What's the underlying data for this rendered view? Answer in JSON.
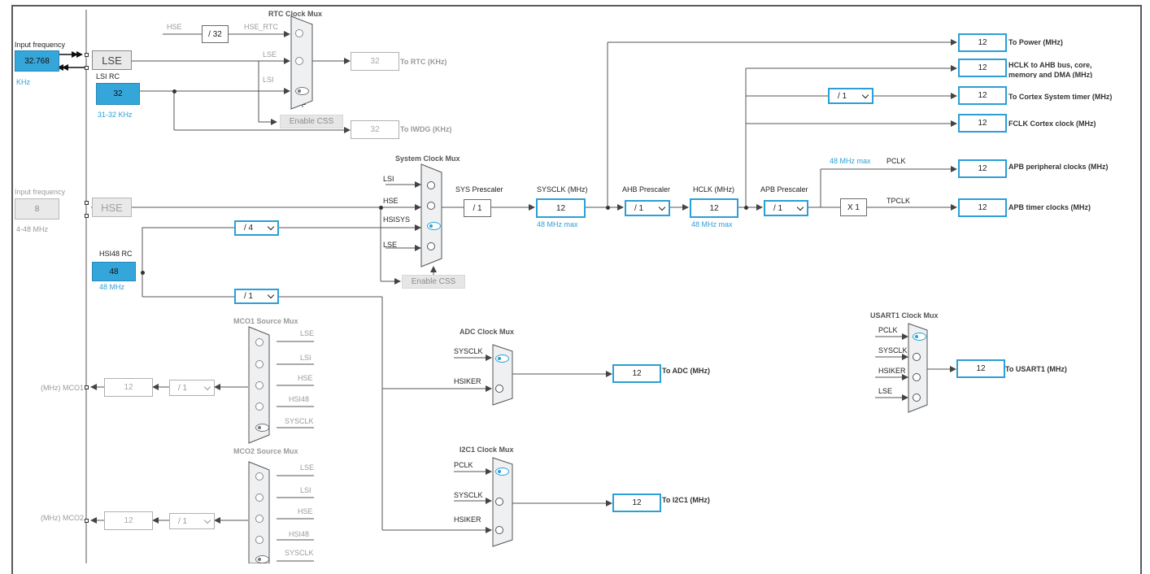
{
  "left_panel": {
    "lse_input_label": "Input frequency",
    "lse_input_value": "32.768",
    "lse_unit": "KHz",
    "lse_label": "LSE",
    "lsi_rc_label": "LSI RC",
    "lsi_rc_value": "32",
    "lsi_range": "31-32 KHz",
    "hse_input_label": "Input frequency",
    "hse_input_value": "8",
    "hse_range": "4-48 MHz",
    "hse_label": "HSE",
    "hsi48_label": "HSI48 RC",
    "hsi48_value": "48",
    "hsi48_unit": "48 MHz"
  },
  "rtc_section": {
    "title": "RTC Clock Mux",
    "hse_label": "HSE",
    "div32": "/ 32",
    "hse_rtc": "HSE_RTC",
    "lse": "LSE",
    "lsi": "LSI",
    "enable_css": "Enable CSS",
    "rtc_value": "32",
    "rtc_label": "To RTC (KHz)",
    "iwdg_value": "32",
    "iwdg_label": "To IWDG (KHz)"
  },
  "system_section": {
    "title": "System Clock Mux",
    "inputs": [
      "LSI",
      "HSE",
      "HSISYS",
      "LSE"
    ],
    "div4": "/ 4",
    "div1": "/ 1",
    "enable_css": "Enable CSS",
    "sys_prescaler_label": "SYS Prescaler",
    "sys_prescaler_value": "/ 1",
    "sysclk_label": "SYSCLK (MHz)",
    "sysclk_value": "12",
    "sysclk_max": "48 MHz max",
    "ahb_prescaler_label": "AHB Prescaler",
    "ahb_prescaler_value": "/ 1",
    "hclk_label": "HCLK (MHz)",
    "hclk_value": "12",
    "hclk_max": "48 MHz max",
    "apb_prescaler_label": "APB Prescaler",
    "apb_prescaler_value": "/ 1",
    "apb_max": "48 MHz max",
    "pclk": "PCLK",
    "x1": "X 1",
    "tpclk": "TPCLK",
    "cortex_div": "/ 1"
  },
  "outputs": [
    {
      "value": "12",
      "label": "To Power (MHz)"
    },
    {
      "value": "12",
      "label": "HCLK to AHB bus, core,",
      "label2": "memory and DMA (MHz)"
    },
    {
      "value": "12",
      "label": "To Cortex System timer (MHz)"
    },
    {
      "value": "12",
      "label": "FCLK Cortex clock (MHz)"
    },
    {
      "value": "12",
      "label": "APB peripheral clocks (MHz)"
    },
    {
      "value": "12",
      "label": "APB timer clocks (MHz)"
    }
  ],
  "mco1": {
    "title": "MCO1 Source Mux",
    "inputs": [
      "LSE",
      "LSI",
      "HSE",
      "HSI48",
      "SYSCLK"
    ],
    "div": "/ 1",
    "value": "12",
    "label": "(MHz) MCO1"
  },
  "mco2": {
    "title": "MCO2 Source Mux",
    "inputs": [
      "LSE",
      "LSI",
      "HSE",
      "HSI48",
      "SYSCLK"
    ],
    "div": "/ 1",
    "value": "12",
    "label": "(MHz) MCO2"
  },
  "adc": {
    "title": "ADC Clock Mux",
    "inputs": [
      "SYSCLK",
      "HSIKER"
    ],
    "value": "12",
    "label": "To ADC (MHz)"
  },
  "i2c1": {
    "title": "I2C1 Clock Mux",
    "inputs": [
      "PCLK",
      "SYSCLK",
      "HSIKER"
    ],
    "value": "12",
    "label": "To I2C1 (MHz)"
  },
  "usart1": {
    "title": "USART1 Clock Mux",
    "inputs": [
      "PCLK",
      "SYSCLK",
      "HSIKER",
      "LSE"
    ],
    "value": "12",
    "label": "To USART1 (MHz)"
  },
  "colors": {
    "accent": "#2b9fd6",
    "wire": "#555555",
    "disabled": "#a8a8a8"
  }
}
